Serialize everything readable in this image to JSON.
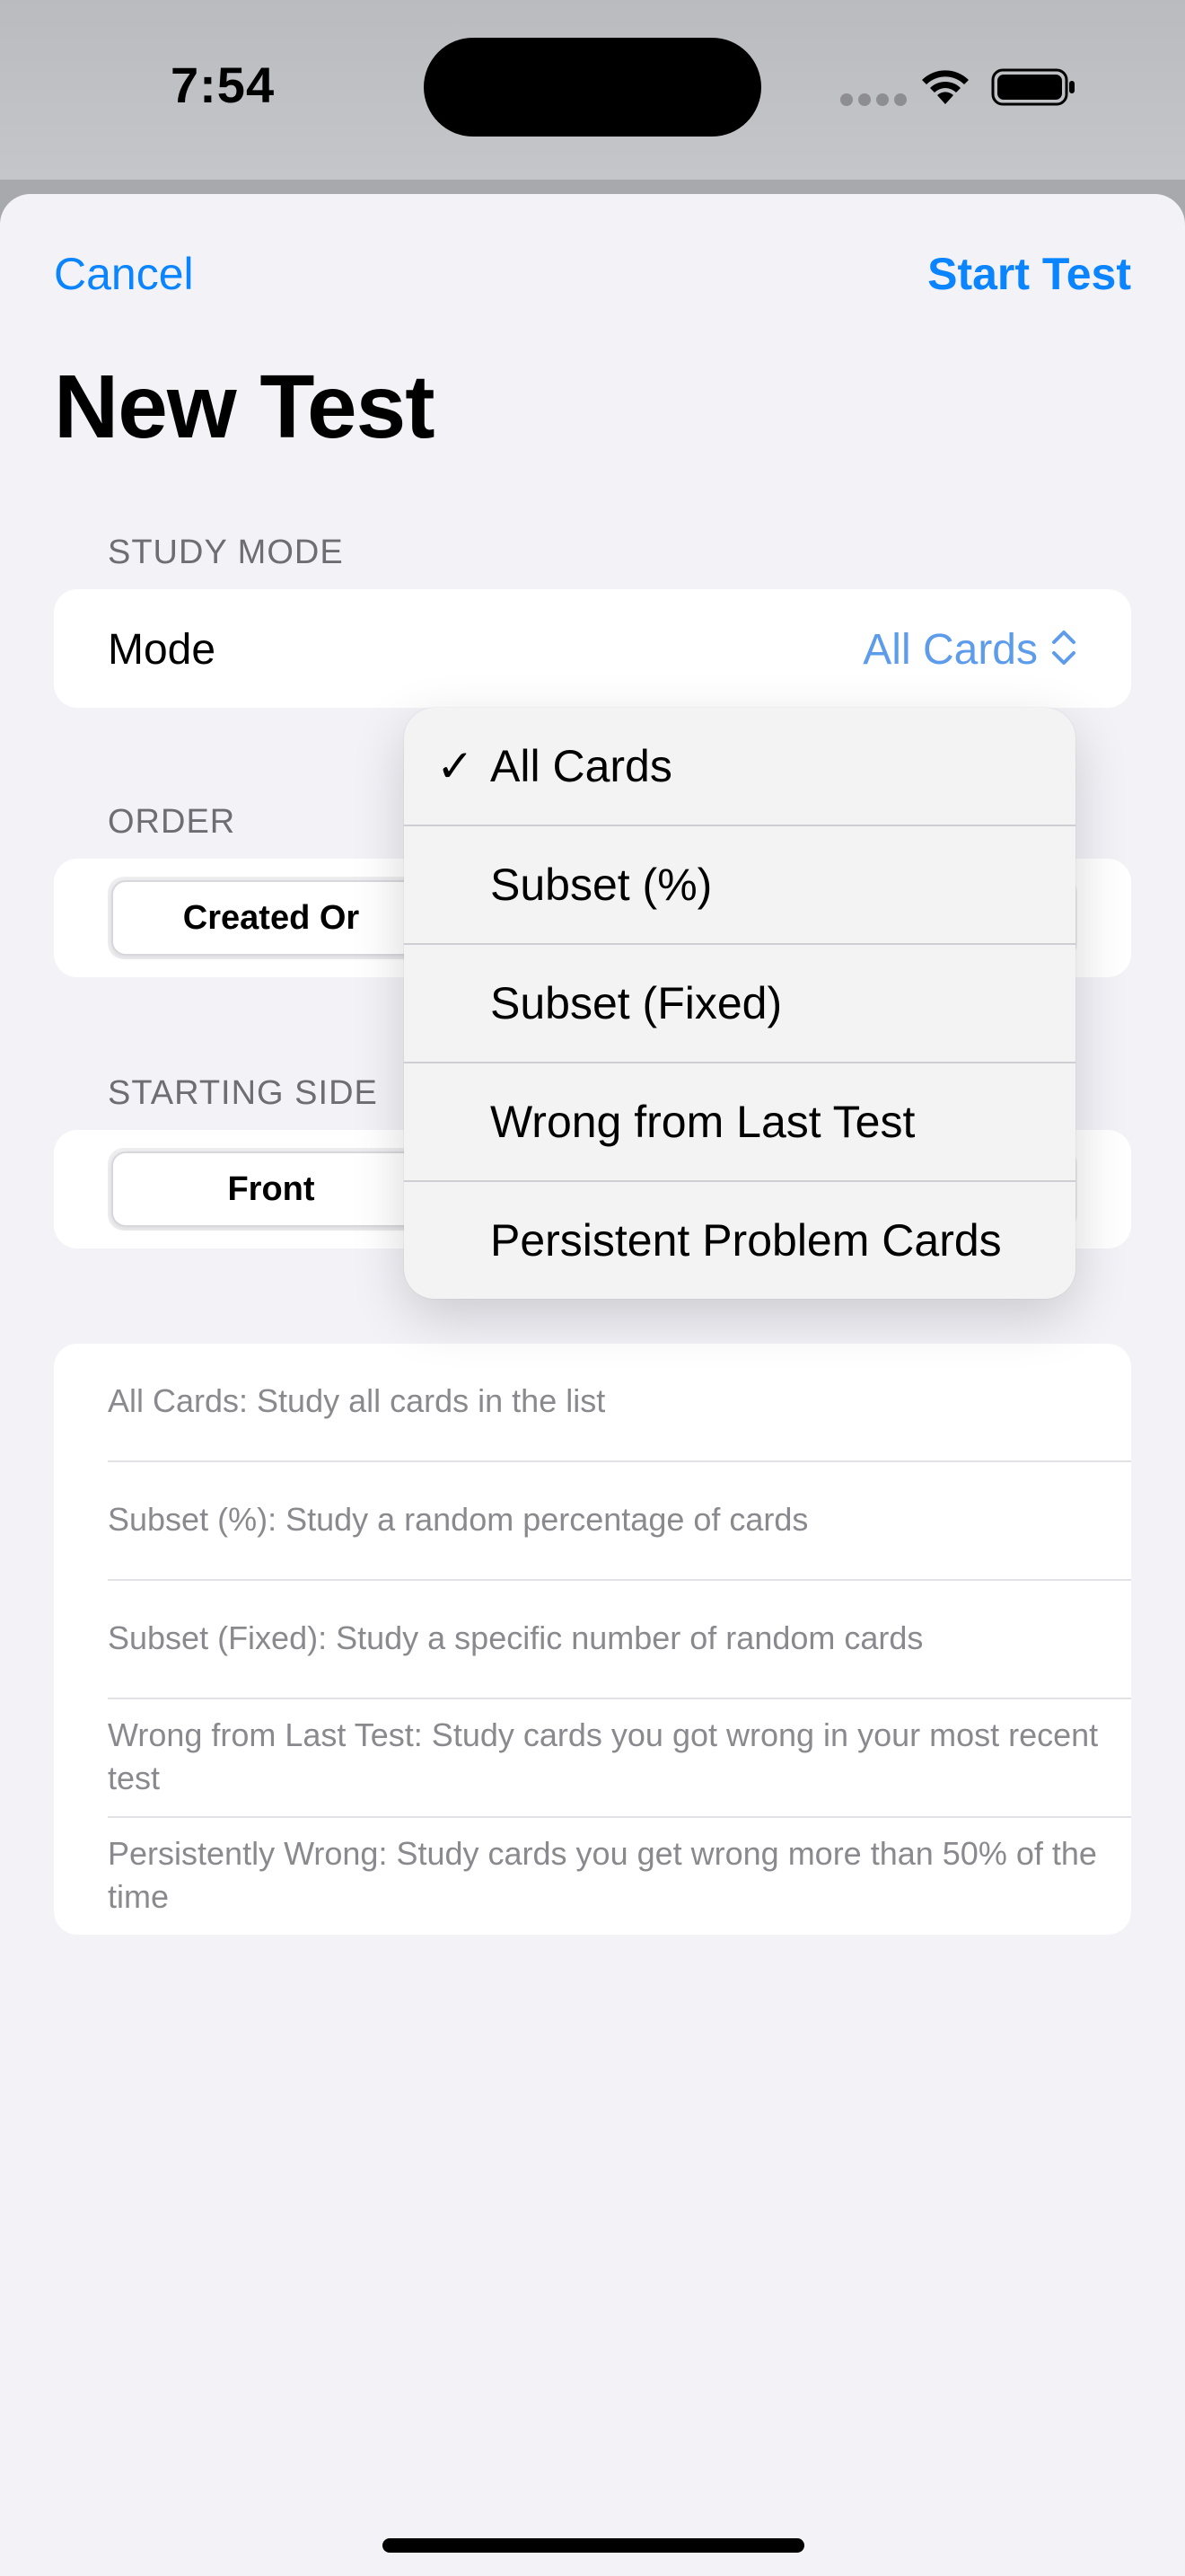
{
  "status_bar": {
    "time": "7:54"
  },
  "nav": {
    "cancel_label": "Cancel",
    "start_label": "Start Test",
    "title": "New Test"
  },
  "study_mode": {
    "header": "STUDY MODE",
    "label": "Mode",
    "value": "All Cards"
  },
  "order": {
    "header": "ORDER",
    "selected_segment": "Created Or"
  },
  "starting_side": {
    "header": "STARTING SIDE",
    "selected_segment": "Front"
  },
  "descriptions": [
    "All Cards: Study all cards in the list",
    "Subset (%): Study a random percentage of cards",
    "Subset (Fixed): Study a specific number of random cards",
    "Wrong from Last Test: Study cards you got wrong in your most recent test",
    "Persistently Wrong: Study cards you get wrong more than 50% of the time"
  ],
  "mode_menu": {
    "checkmark": "✓",
    "items": [
      "All Cards",
      "Subset (%)",
      "Subset (Fixed)",
      "Wrong from Last Test",
      "Persistent Problem Cards"
    ],
    "selected": "All Cards"
  },
  "colors": {
    "accent": "#0a84ff",
    "picker_value": "#5d9cea",
    "background": "#f2f2f7"
  }
}
